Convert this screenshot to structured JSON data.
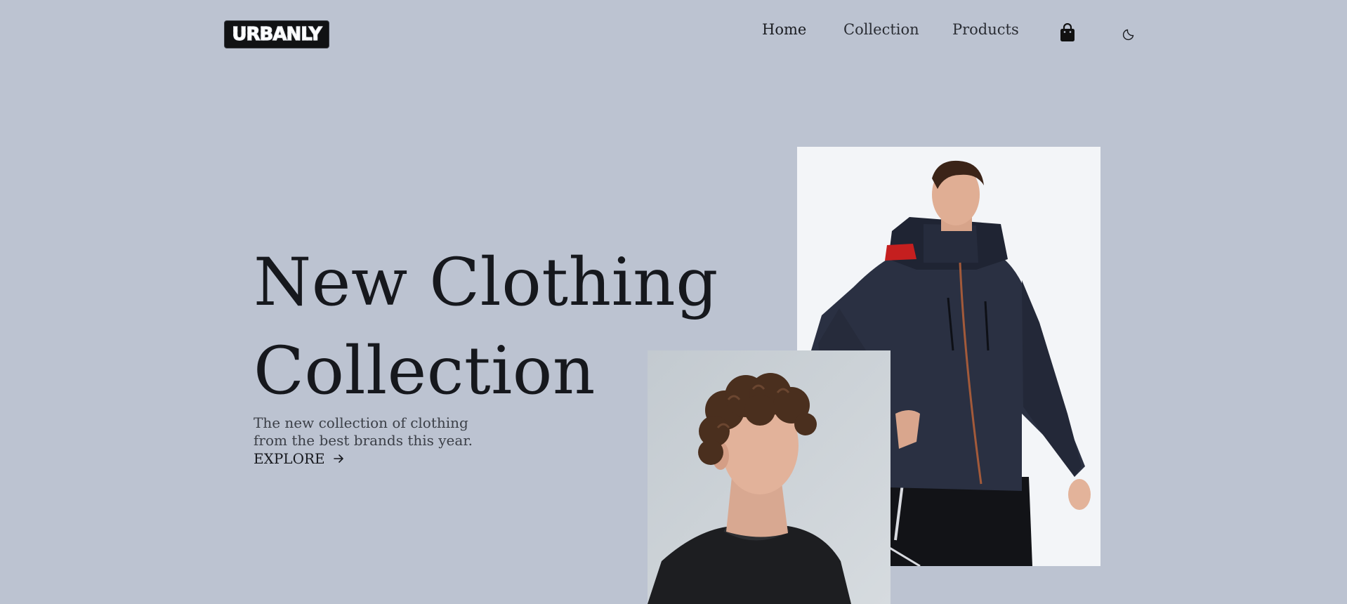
{
  "brand": {
    "logo_text": "URBANLY"
  },
  "nav": {
    "items": [
      {
        "label": "Home",
        "active": true
      },
      {
        "label": "Collection",
        "active": false
      },
      {
        "label": "Products",
        "active": false
      }
    ],
    "cart_icon": "shopping-bag-icon",
    "theme_icon": "moon-icon"
  },
  "hero": {
    "title_line1": "New Clothing",
    "title_line2": "Collection",
    "description": "The new collection of clothing from the best brands this year.",
    "cta_label": "EXPLORE",
    "cta_icon": "arrow-right-icon"
  },
  "images": {
    "primary": "model-in-navy-jacket-photo",
    "secondary": "curly-haired-model-portrait-photo"
  },
  "colors": {
    "background": "#bcc3d1",
    "text": "#16181d",
    "logo_bg": "#111214"
  }
}
